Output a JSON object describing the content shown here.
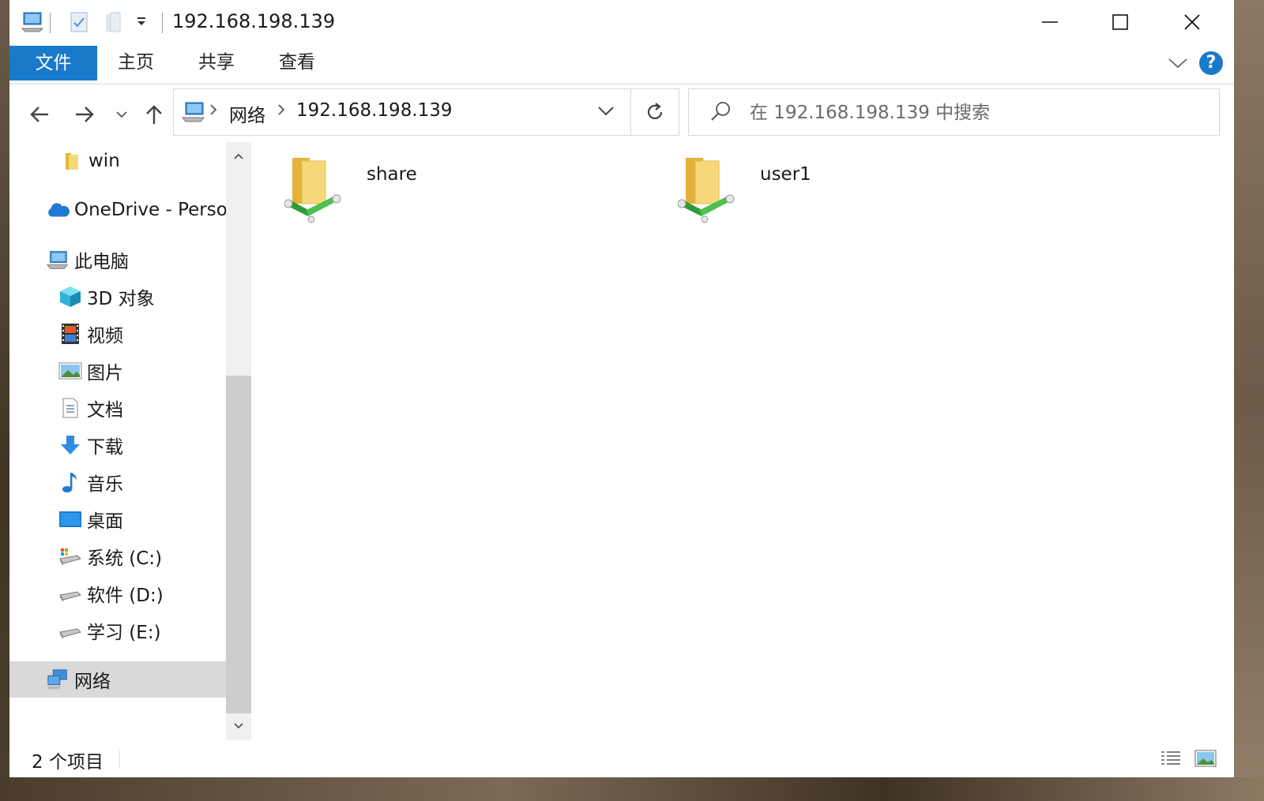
{
  "window": {
    "title": "192.168.198.139"
  },
  "ribbon": {
    "tabs": [
      "文件",
      "主页",
      "共享",
      "查看"
    ],
    "help_label": "?"
  },
  "address": {
    "crumbs": [
      "网络",
      "192.168.198.139"
    ]
  },
  "search": {
    "placeholder": "在 192.168.198.139 中搜索"
  },
  "sidebar": {
    "items": [
      {
        "label": "win",
        "icon": "folder-icon"
      },
      {
        "label": "OneDrive - Perso",
        "icon": "onedrive-cloud-icon"
      },
      {
        "label": "此电脑",
        "icon": "this-pc-icon"
      },
      {
        "label": "3D 对象",
        "icon": "3d-objects-icon"
      },
      {
        "label": "视频",
        "icon": "video-icon"
      },
      {
        "label": "图片",
        "icon": "pictures-icon"
      },
      {
        "label": "文档",
        "icon": "documents-icon"
      },
      {
        "label": "下载",
        "icon": "downloads-icon"
      },
      {
        "label": "音乐",
        "icon": "music-icon"
      },
      {
        "label": "桌面",
        "icon": "desktop-icon"
      },
      {
        "label": "系统 (C:)",
        "icon": "system-drive-icon"
      },
      {
        "label": "软件 (D:)",
        "icon": "drive-icon"
      },
      {
        "label": "学习 (E:)",
        "icon": "drive-icon"
      },
      {
        "label": "网络",
        "icon": "network-icon",
        "selected": true
      }
    ]
  },
  "content": {
    "items": [
      {
        "label": "share",
        "icon": "shared-folder-icon"
      },
      {
        "label": "user1",
        "icon": "shared-folder-icon"
      }
    ]
  },
  "status": {
    "item_count": "2 个项目"
  },
  "colors": {
    "accent": "#1979ca",
    "selected_bg": "#d9d9d9",
    "folder_yellow": "#f3cf6a",
    "share_green": "#3aa83a"
  }
}
